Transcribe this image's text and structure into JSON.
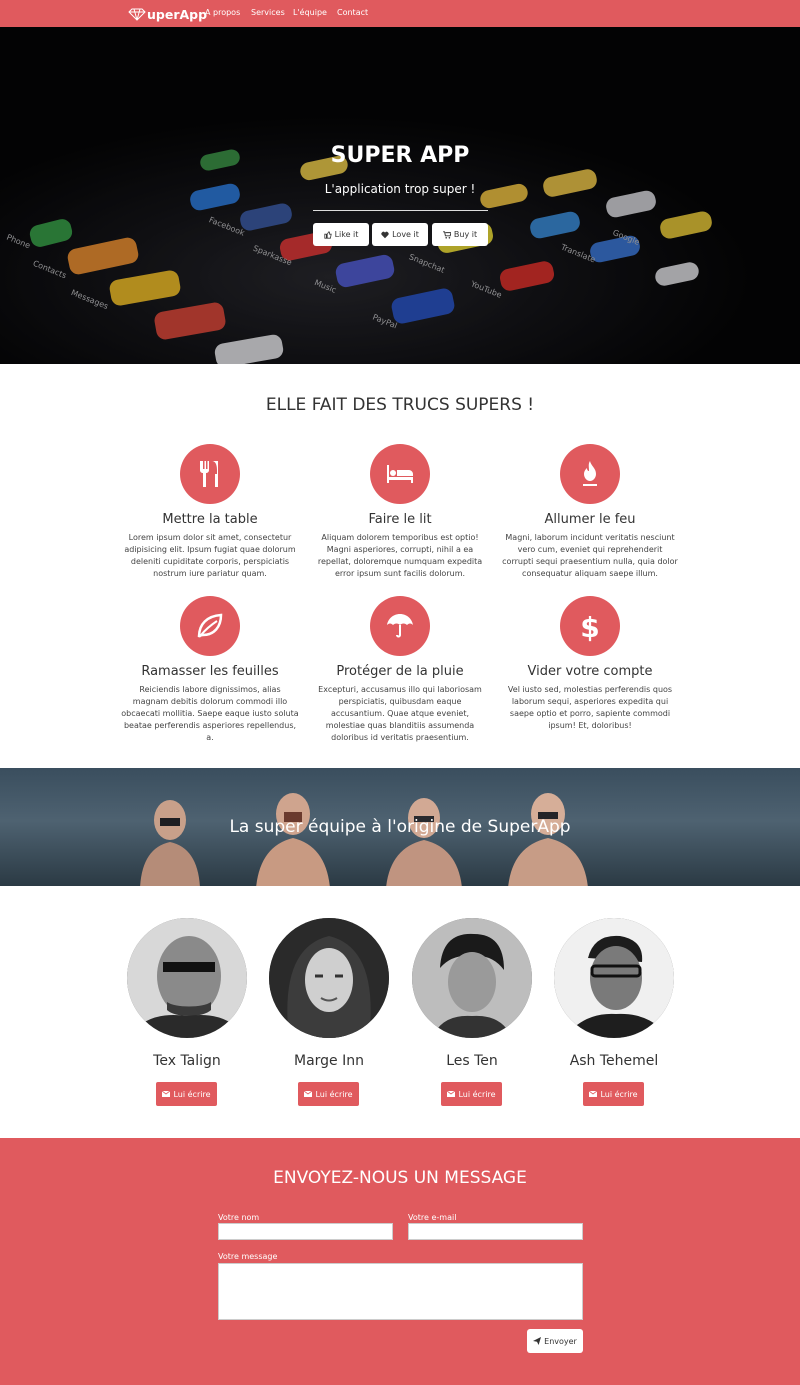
{
  "nav": {
    "brand": "uperApp",
    "links": [
      "A propos",
      "Services",
      "L'équipe",
      "Contact"
    ]
  },
  "hero": {
    "title": "SUPER APP",
    "subtitle": "L'application trop super !",
    "buttons": [
      {
        "label": "Like it",
        "icon": "thumbs-up-icon"
      },
      {
        "label": "Love it",
        "icon": "heart-icon"
      },
      {
        "label": "Buy it",
        "icon": "cart-icon"
      }
    ],
    "app_names": [
      "Phone",
      "Contacts",
      "Messages",
      "Facebook",
      "Sparkasse",
      "Music",
      "Snapchat",
      "YouTube",
      "PayPal",
      "Translate",
      "Google"
    ]
  },
  "features": {
    "title": "ELLE FAIT DES TRUCS SUPERS !",
    "items": [
      {
        "icon": "cutlery-icon",
        "title": "Mettre la table",
        "text": "Lorem ipsum dolor sit amet, consectetur adipisicing elit. Ipsum fugiat quae dolorum deleniti cupiditate corporis, perspiciatis nostrum iure pariatur quam."
      },
      {
        "icon": "bed-icon",
        "title": "Faire le lit",
        "text": "Aliquam dolorem temporibus est optio! Magni asperiores, corrupti, nihil a ea repellat, doloremque numquam expedita error ipsum sunt facilis dolorum."
      },
      {
        "icon": "fire-icon",
        "title": "Allumer le feu",
        "text": "Magni, laborum incidunt veritatis nesciunt vero cum, eveniet qui reprehenderit corrupti sequi praesentium nulla, quia dolor consequatur aliquam saepe illum."
      },
      {
        "icon": "leaf-icon",
        "title": "Ramasser les feuilles",
        "text": "Reiciendis labore dignissimos, alias magnam debitis dolorum commodi illo obcaecati mollitia. Saepe eaque iusto soluta beatae perferendis asperiores repellendus, a."
      },
      {
        "icon": "umbrella-icon",
        "title": "Protéger de la pluie",
        "text": "Excepturi, accusamus illo qui laboriosam perspiciatis, quibusdam eaque accusantium. Quae atque eveniet, molestiae quas blanditiis assumenda doloribus id veritatis praesentium."
      },
      {
        "icon": "dollar-icon",
        "title": "Vider votre compte",
        "text": "Vel iusto sed, molestias perferendis quos laborum sequi, asperiores expedita qui saepe optio et porro, sapiente commodi ipsum! Et, doloribus!"
      }
    ]
  },
  "team": {
    "banner_title": "La super équipe à l'origine de SuperApp",
    "members": [
      {
        "name": "Tex Talign",
        "button": "Lui écrire"
      },
      {
        "name": "Marge Inn",
        "button": "Lui écrire"
      },
      {
        "name": "Les Ten",
        "button": "Lui écrire"
      },
      {
        "name": "Ash Tehemel",
        "button": "Lui écrire"
      }
    ]
  },
  "contact": {
    "title": "ENVOYEZ-NOUS UN MESSAGE",
    "name_label": "Votre nom",
    "email_label": "Votre e-mail",
    "message_label": "Votre message",
    "name_value": "",
    "email_value": "",
    "message_value": "",
    "send_label": "Envoyer"
  },
  "colors": {
    "accent": "#e05a5e",
    "text": "#333333"
  }
}
